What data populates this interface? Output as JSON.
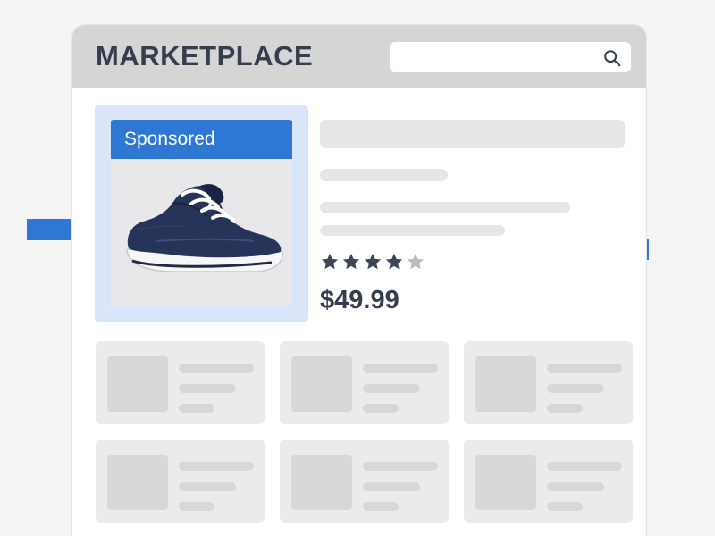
{
  "header": {
    "brand": "MARKETPLACE",
    "search": {
      "value": "",
      "placeholder": "",
      "icon": "search-icon"
    }
  },
  "featured": {
    "badge": "Sponsored",
    "image": "sneaker-image",
    "rating": {
      "value": 4,
      "max": 5
    },
    "price": "$49.99",
    "indicator_icons": [
      "arrow-right-icon",
      "arrow-left-icon"
    ]
  },
  "colors": {
    "accent": "#2e77d2",
    "highlight_bg": "#d9e5f8",
    "brand_text": "#343e4f",
    "star_filled": "#3d4655",
    "star_empty": "#b8bcc2",
    "placeholder": "#e6e6e6"
  },
  "grid": {
    "rows": 2,
    "columns": 3
  }
}
